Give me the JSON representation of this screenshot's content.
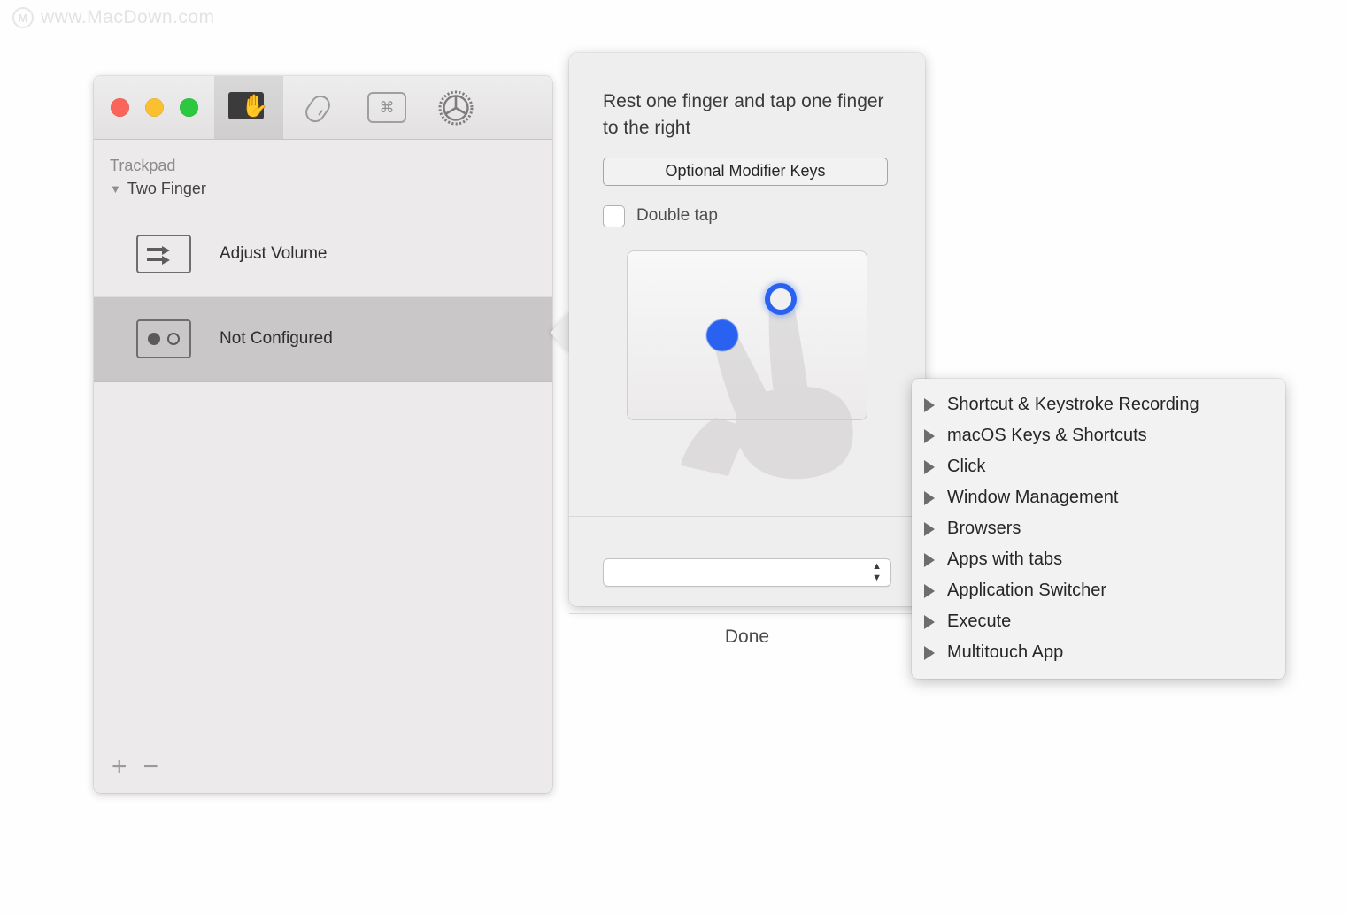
{
  "watermark": {
    "logo_letter": "M",
    "text": "www.MacDown.com",
    "icon": "macdown-logo-icon"
  },
  "window": {
    "traffic_lights": [
      {
        "name": "close-button",
        "color": "#f9655b"
      },
      {
        "name": "minimize-button",
        "color": "#fbc02f"
      },
      {
        "name": "zoom-button",
        "color": "#2bc840"
      }
    ],
    "toolbar_tabs": [
      {
        "icon": "trackpad-hand-icon",
        "selected": true
      },
      {
        "icon": "mouse-icon",
        "selected": false
      },
      {
        "icon": "keyboard-command-key-icon",
        "selected": false
      },
      {
        "icon": "gear-settings-icon",
        "selected": false
      }
    ],
    "sidebar": {
      "section_title": "Trackpad",
      "group_label": "Two Finger",
      "group_caret": "▼",
      "rows": [
        {
          "label": "Adjust Volume",
          "icon": "two-arrows-right-icon",
          "selected": false
        },
        {
          "label": "Not Configured",
          "icon": "dot-filled-dot-hollow-icon",
          "selected": true
        }
      ],
      "footer": {
        "add_label": "+",
        "remove_label": "−"
      }
    }
  },
  "popover": {
    "instruction": "Rest one finger and tap one finger to the right",
    "modifier_button_label": "Optional Modifier Keys",
    "double_tap_label": "Double tap",
    "double_tap_checked": false,
    "illustration": {
      "name": "trackpad-two-finger-illustration",
      "resting_finger_dot": "solid-blue-dot",
      "tapping_finger_dot": "blue-ring-dot",
      "accent_color": "#2962f0"
    },
    "action_select_value": "",
    "stepper_up": "▲",
    "stepper_down": "▼",
    "done_label": "Done"
  },
  "menu": {
    "items": [
      {
        "label": "Shortcut & Keystroke Recording",
        "has_submenu": true
      },
      {
        "label": "macOS Keys & Shortcuts",
        "has_submenu": true
      },
      {
        "label": "Click",
        "has_submenu": true
      },
      {
        "label": "Window Management",
        "has_submenu": true
      },
      {
        "label": "Browsers",
        "has_submenu": true
      },
      {
        "label": "Apps with tabs",
        "has_submenu": true
      },
      {
        "label": "Application Switcher",
        "has_submenu": true
      },
      {
        "label": "Execute",
        "has_submenu": true
      },
      {
        "label": "Multitouch App",
        "has_submenu": true
      }
    ]
  }
}
